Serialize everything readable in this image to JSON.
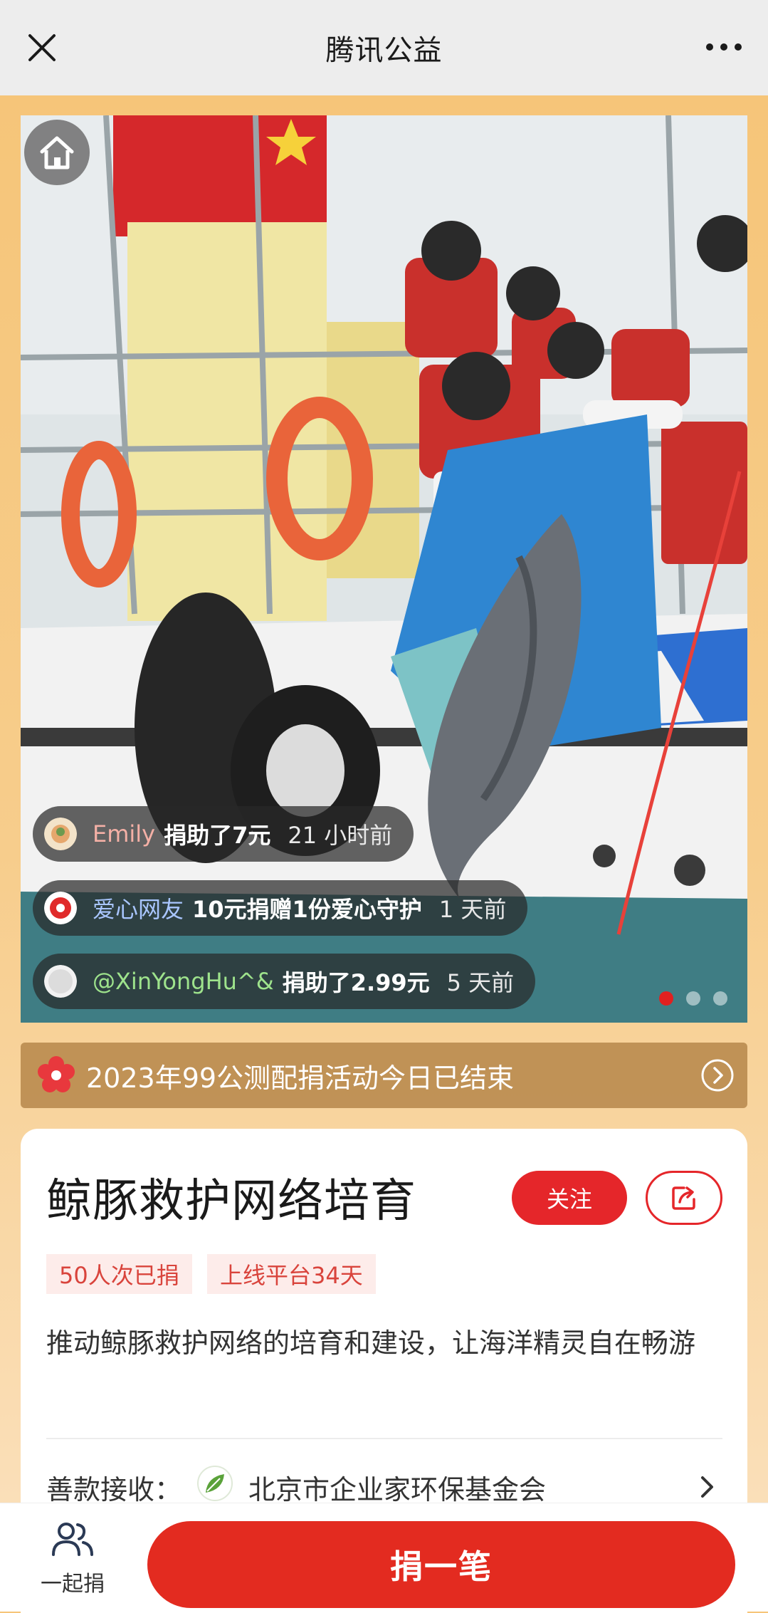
{
  "topbar": {
    "title": "腾讯公益"
  },
  "hero": {
    "donations": [
      {
        "name": "Emily",
        "action": "捐助了7元",
        "time": "21 小时前",
        "name_color": "#f4b0a6"
      },
      {
        "name": "爱心网友",
        "action": "10元捐赠1份爱心守护",
        "time": "1 天前",
        "name_color": "#a9c6ff"
      },
      {
        "name": "@XinYongHu^&",
        "action": "捐助了2.99元",
        "time": "5 天前",
        "name_color": "#9ee38c"
      }
    ]
  },
  "notice": {
    "text": "2023年99公测配捐活动今日已结束"
  },
  "project": {
    "title": "鲸豚救护网络培育",
    "follow_label": "关注",
    "tags": [
      "50人次已捐",
      "上线平台34天"
    ],
    "description": "推动鲸豚救护网络的培育和建设，让海洋精灵自在畅游",
    "receiver_label": "善款接收：",
    "receiver_org": "北京市企业家环保基金会"
  },
  "bottom": {
    "together_label": "一起捐",
    "donate_label": "捐一笔"
  },
  "colors": {
    "accent": "#e32b20",
    "background": "#f6c579"
  }
}
